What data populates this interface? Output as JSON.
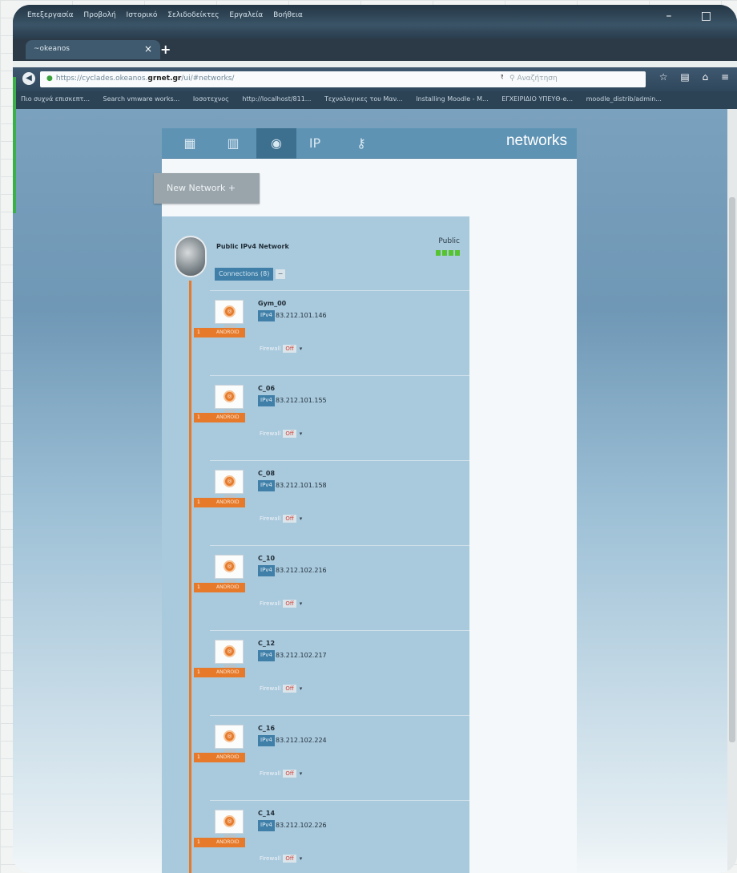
{
  "window": {
    "menu": [
      "Επεξεργασία",
      "Προβολή",
      "Ιστορικό",
      "Σελιδοδείκτες",
      "Εργαλεία",
      "Βοήθεια"
    ],
    "tab_title": "~okeanos"
  },
  "address_bar": {
    "url_prefix": "https://cyclades.okeanos.",
    "url_domain": "grnet.gr",
    "url_suffix": "/ui/#networks/",
    "search_placeholder": "Αναζήτηση"
  },
  "bookmarks": [
    "Πιο συχνά επισκεπτ...",
    "Search vmware works...",
    "Ιοσοτεχνος",
    "http://localhost/811...",
    "Τεχνολογικες του Μαν...",
    "Installing Moodle - M...",
    "ΕΓΧΕΙΡΙΔΙΟ ΥΠΕΥΘ-e...",
    "moodle_distrib/admin..."
  ],
  "app": {
    "title": "networks",
    "tools": [
      "server-icon",
      "storage-icon",
      "network-icon",
      "ip-icon",
      "key-icon"
    ],
    "new_network_label": "New Network +"
  },
  "network": {
    "name": "Public IPv4 Network",
    "type": "Public",
    "connections_label": "Connections (8)",
    "vms": [
      {
        "name": "Gym_00",
        "ip_type": "IPv4",
        "ip": "83.212.101.146",
        "firewall_label": "Firewall",
        "firewall_state": "Off",
        "badge_num": "1",
        "badge_text": "ANDROID"
      },
      {
        "name": "C_06",
        "ip_type": "IPv4",
        "ip": "83.212.101.155",
        "firewall_label": "Firewall",
        "firewall_state": "Off",
        "badge_num": "1",
        "badge_text": "ANDROID"
      },
      {
        "name": "C_08",
        "ip_type": "IPv4",
        "ip": "83.212.101.158",
        "firewall_label": "Firewall",
        "firewall_state": "Off",
        "badge_num": "1",
        "badge_text": "ANDROID"
      },
      {
        "name": "C_10",
        "ip_type": "IPv4",
        "ip": "83.212.102.216",
        "firewall_label": "Firewall",
        "firewall_state": "Off",
        "badge_num": "1",
        "badge_text": "ANDROID"
      },
      {
        "name": "C_12",
        "ip_type": "IPv4",
        "ip": "83.212.102.217",
        "firewall_label": "Firewall",
        "firewall_state": "Off",
        "badge_num": "1",
        "badge_text": "ANDROID"
      },
      {
        "name": "C_16",
        "ip_type": "IPv4",
        "ip": "83.212.102.224",
        "firewall_label": "Firewall",
        "firewall_state": "Off",
        "badge_num": "1",
        "badge_text": "ANDROID"
      },
      {
        "name": "C_14",
        "ip_type": "IPv4",
        "ip": "83.212.102.226",
        "firewall_label": "Firewall",
        "firewall_state": "Off",
        "badge_num": "1",
        "badge_text": "ANDROID"
      }
    ]
  },
  "colors": {
    "accent": "#e67a2a",
    "header": "#5f93b4",
    "card": "#a9c9dd",
    "status_ok": "#56c42f"
  }
}
